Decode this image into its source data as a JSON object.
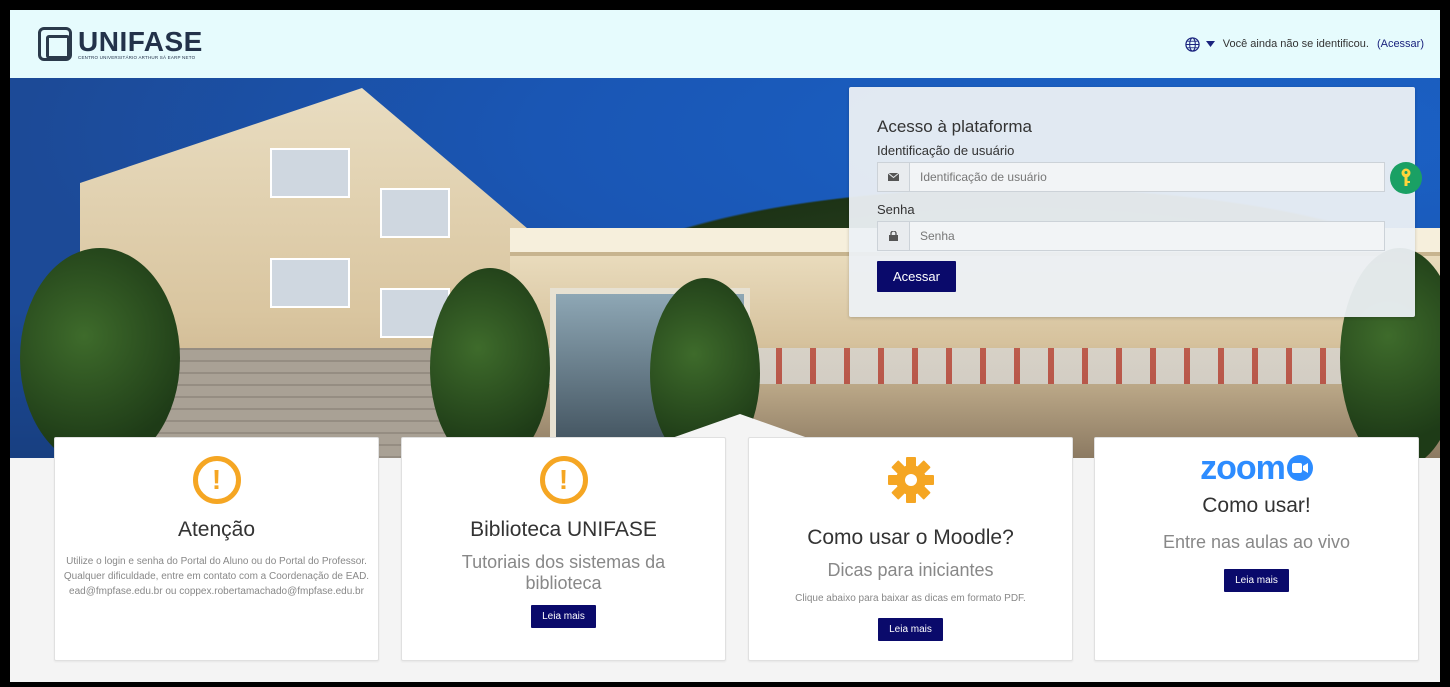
{
  "brand": {
    "name": "UNIFASE",
    "tagline": "CENTRO UNIVERSITÁRIO ARTHUR SÁ EARP NETO"
  },
  "header": {
    "status_text": "Você ainda não se identificou.",
    "login_link": "(Acessar)"
  },
  "login": {
    "title": "Acesso à plataforma",
    "username_label": "Identificação de usuário",
    "username_placeholder": "Identificação de usuário",
    "password_label": "Senha",
    "password_placeholder": "Senha",
    "submit_label": "Acessar"
  },
  "cards": [
    {
      "icon": "warning-icon",
      "title": "Atenção",
      "text": "Utilize o login e senha do Portal do Aluno ou do Portal do Professor. Qualquer dificuldade, entre em contato com a Coordenação de EAD. ead@fmpfase.edu.br ou coppex.robertamachado@fmpfase.edu.br"
    },
    {
      "icon": "warning-icon",
      "title": "Biblioteca UNIFASE",
      "subtitle": "Tutoriais dos sistemas da biblioteca",
      "button": "Leia mais"
    },
    {
      "icon": "gear-icon",
      "title": "Como usar o Moodle?",
      "subtitle": "Dicas para iniciantes",
      "text": "Clique abaixo para baixar as dicas em formato PDF.",
      "button": "Leia mais"
    },
    {
      "icon": "zoom-logo",
      "logo_text": "zoom",
      "title": "Como usar!",
      "subtitle": "Entre nas aulas ao vivo",
      "button": "Leia mais"
    }
  ],
  "colors": {
    "primary": "#0a0a6b",
    "accent": "#f5a623",
    "zoom": "#2d8cff",
    "navbar": "#e6fbfd"
  }
}
